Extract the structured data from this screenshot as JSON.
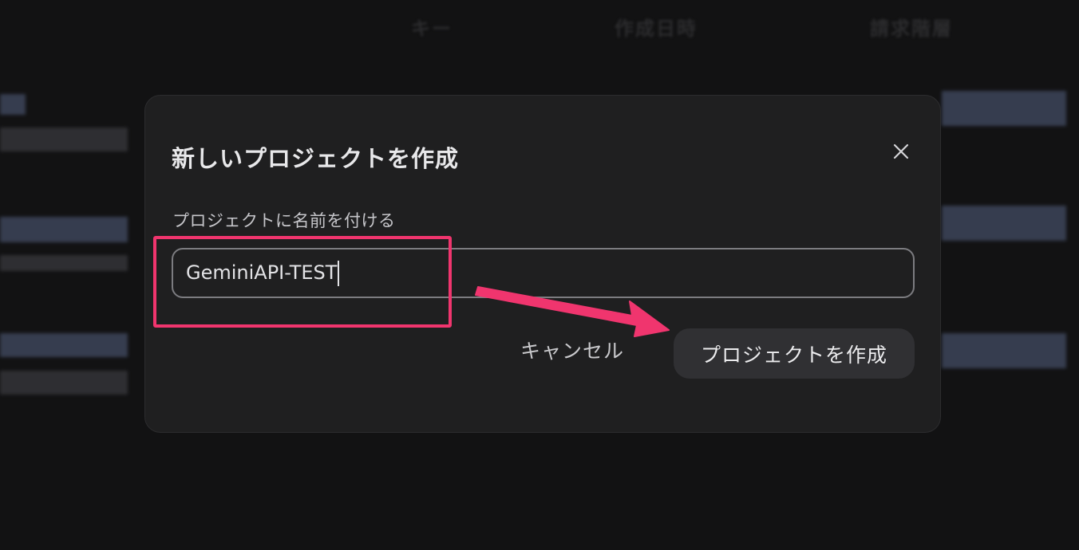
{
  "background": {
    "columns": [
      "キー",
      "作成日時",
      "請求階層"
    ]
  },
  "modal": {
    "title": "新しいプロジェクトを作成",
    "field_label": "プロジェクトに名前を付ける",
    "input_value": "GeminiAPI-TEST",
    "cancel_label": "キャンセル",
    "create_label": "プロジェクトを作成",
    "close_icon": "close-icon"
  },
  "annotation": {
    "color": "#f0356e"
  }
}
